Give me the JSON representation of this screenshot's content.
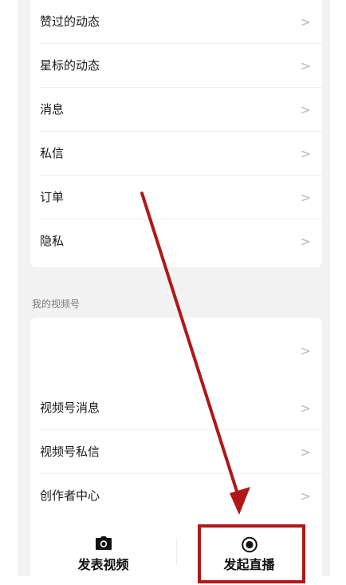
{
  "menu_top": [
    {
      "label": "赞过的动态"
    },
    {
      "label": "星标的动态"
    },
    {
      "label": "消息"
    },
    {
      "label": "私信"
    },
    {
      "label": "订单"
    },
    {
      "label": "隐私"
    }
  ],
  "section": {
    "title": "我的视频号"
  },
  "menu_channel": [
    {
      "label": ""
    },
    {
      "label": "视频号消息"
    },
    {
      "label": "视频号私信"
    },
    {
      "label": "创作者中心"
    }
  ],
  "actions": {
    "post_video": {
      "label": "发表视频",
      "icon": "camera-icon"
    },
    "go_live": {
      "label": "发起直播",
      "icon": "record-icon"
    }
  },
  "chevron": ">",
  "colors": {
    "annotation": "#b01818",
    "background": "#f2f2f2",
    "card": "#ffffff",
    "chevron": "#b9b9b9"
  }
}
